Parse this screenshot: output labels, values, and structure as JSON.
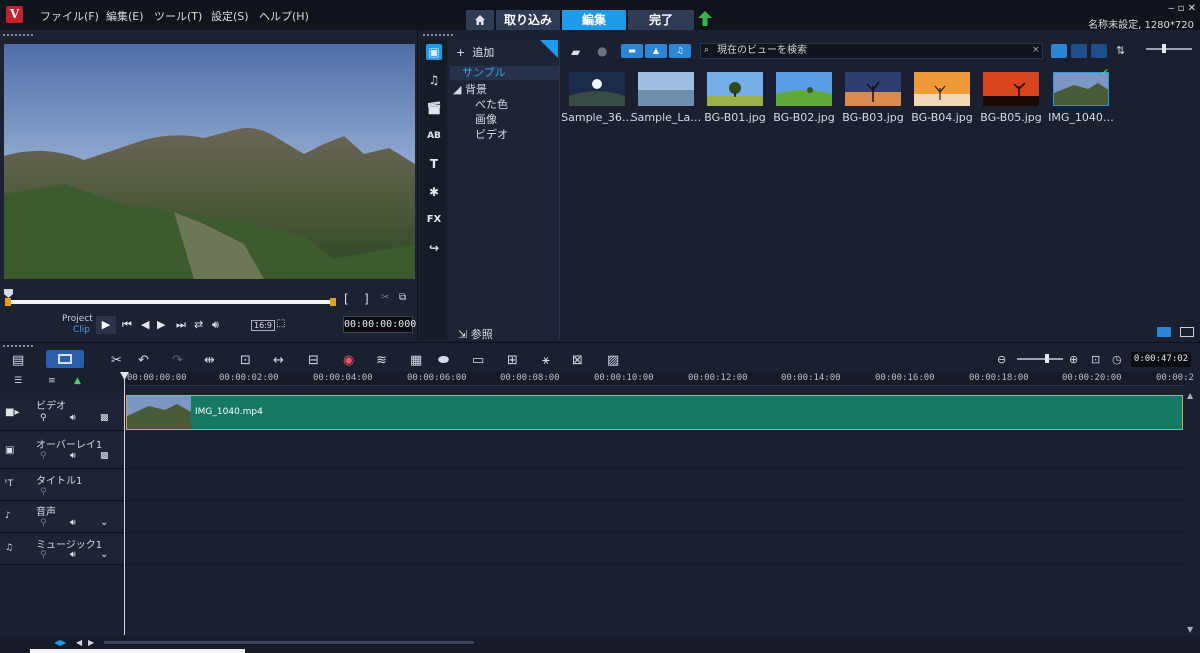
{
  "menu": {
    "items": [
      "ファイル(F)",
      "編集(E)",
      "ツール(T)",
      "設定(S)",
      "ヘルプ(H)"
    ]
  },
  "mode_tabs": {
    "capture": "取り込み",
    "edit": "編集",
    "finish": "完了"
  },
  "window": {
    "controls": "‒ ▫ ✕",
    "project_info": "名称未設定, 1280*720"
  },
  "preview": {
    "project_label": "Project",
    "clip_label": "Clip",
    "timecode": "00:00:00:000",
    "aspect": "16:9",
    "mark_in": "[",
    "mark_out": "]"
  },
  "library": {
    "add_label": "追加",
    "tree": {
      "sample": "サンプル",
      "background": "背景",
      "solid": "べた色",
      "image": "画像",
      "video": "ビデオ"
    },
    "browse_label": "参照",
    "search_placeholder": "現在のビューを検索",
    "thumbnails": [
      {
        "label": "Sample_36…",
        "scene": "panorama"
      },
      {
        "label": "Sample_La…",
        "scene": "lake"
      },
      {
        "label": "BG-B01.jpg",
        "scene": "tree-field"
      },
      {
        "label": "BG-B02.jpg",
        "scene": "green-hill"
      },
      {
        "label": "BG-B03.jpg",
        "scene": "dusk-tree"
      },
      {
        "label": "BG-B04.jpg",
        "scene": "desert"
      },
      {
        "label": "BG-B05.jpg",
        "scene": "red-sunset"
      },
      {
        "label": "IMG_1040…",
        "scene": "mountain"
      }
    ]
  },
  "timeline": {
    "timecode": "0:00:47:02",
    "ticks": [
      "00:00:00:00",
      "00:00:02:00",
      "00:00:04:00",
      "00:00:06:00",
      "00:00:08:00",
      "00:00:10:00",
      "00:00:12:00",
      "00:00:14:00",
      "00:00:16:00",
      "00:00:18:00",
      "00:00:20:00",
      "00:00:2"
    ],
    "tracks": [
      {
        "name": "ビデオ"
      },
      {
        "name": "オーバーレイ1"
      },
      {
        "name": "タイトル1"
      },
      {
        "name": "音声"
      },
      {
        "name": "ミュージック1"
      }
    ],
    "clip_name": "IMG_1040.mp4"
  },
  "colors": {
    "accent": "#1e9be8",
    "clip": "#157860",
    "clip_border": "#d9a441"
  }
}
